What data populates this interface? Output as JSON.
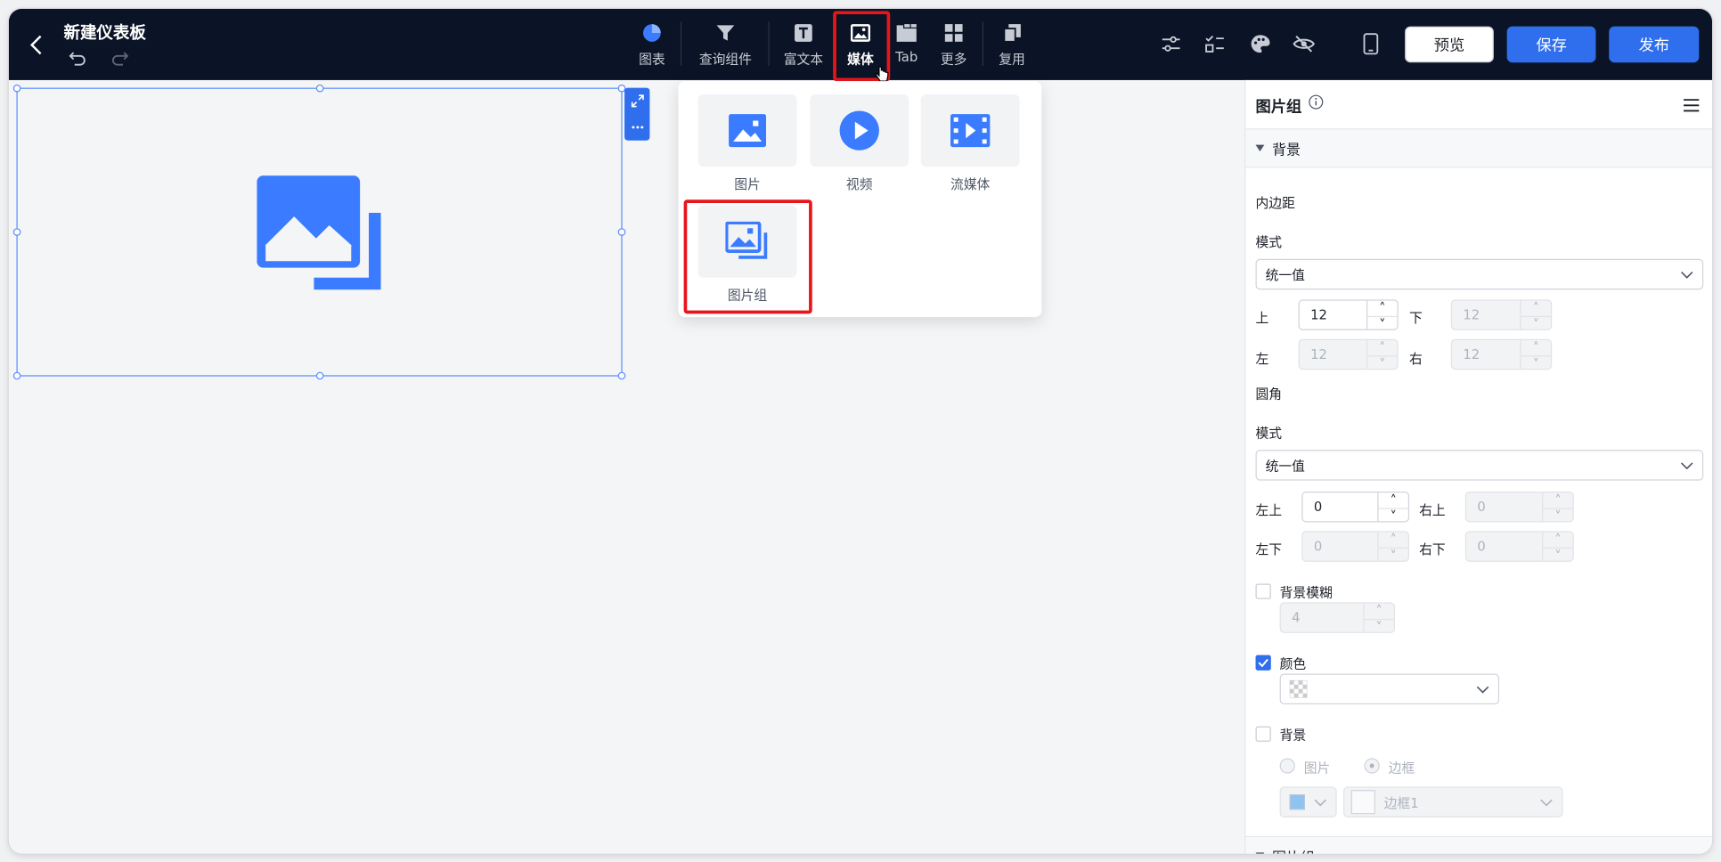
{
  "header": {
    "title": "新建仪表板",
    "tools": [
      {
        "label": "图表"
      },
      {
        "label": "查询组件"
      },
      {
        "label": "富文本"
      },
      {
        "label": "媒体"
      },
      {
        "label": "Tab"
      },
      {
        "label": "更多"
      },
      {
        "label": "复用"
      }
    ],
    "preview_label": "预览",
    "save_label": "保存",
    "publish_label": "发布"
  },
  "media_popup": {
    "items": [
      {
        "label": "图片"
      },
      {
        "label": "视频"
      },
      {
        "label": "流媒体"
      },
      {
        "label": "图片组"
      }
    ]
  },
  "panel": {
    "title": "图片组",
    "background_section": "背景",
    "padding_label": "内边距",
    "mode_label": "模式",
    "padding_mode": "统一值",
    "top_label": "上",
    "bottom_label": "下",
    "left_label": "左",
    "right_label": "右",
    "padding_top": "12",
    "padding_bottom": "12",
    "padding_left": "12",
    "padding_right": "12",
    "radius_label": "圆角",
    "radius_mode": "统一值",
    "tl_label": "左上",
    "tr_label": "右上",
    "bl_label": "左下",
    "br_label": "右下",
    "radius_tl": "0",
    "radius_tr": "0",
    "radius_bl": "0",
    "radius_br": "0",
    "blur_label": "背景模糊",
    "blur_value": "4",
    "color_label": "颜色",
    "background_label": "背景",
    "bg_image_label": "图片",
    "bg_border_label": "边框",
    "border_select": "边框1",
    "image_group_section": "图片组"
  },
  "colors": {
    "accent": "#2f6fed",
    "topbar": "#0b1426",
    "highlight": "#e8151b"
  }
}
